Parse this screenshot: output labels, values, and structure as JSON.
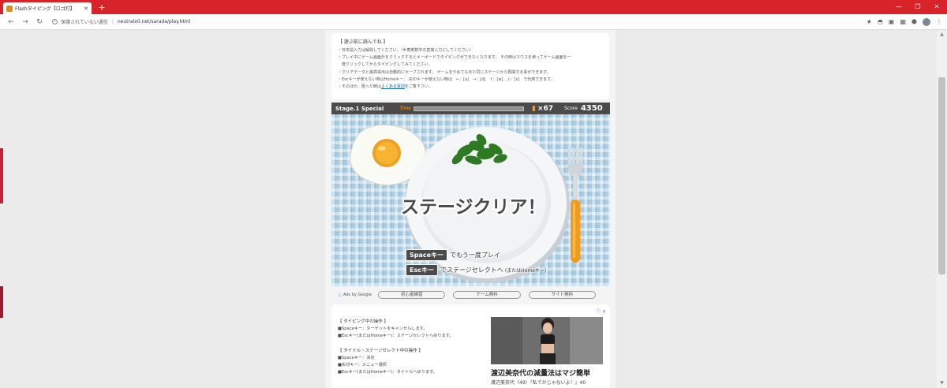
{
  "browser": {
    "tab_title": "Flashタイピング【ロゴ打】",
    "tab_close": "✕",
    "new_tab": "+",
    "nav": {
      "back": "←",
      "forward": "→",
      "reload": "↻"
    },
    "security_label": "保護されていない通信",
    "url": "neutralx0.net/sarada/play.html",
    "toolbar_icons": {
      "bookmark": "★",
      "menu": "⋮"
    },
    "window_controls": {
      "minimize": "—",
      "restore": "❐",
      "close": "✕"
    }
  },
  "notice": {
    "title": "【 遊ぶ前に読んでね 】",
    "lines": [
      "・日本語入力は解除してください。（半角英数字の直接入力にしてください）",
      "・プレイ中にゲーム画面外をクリックするとキーボードでタイピングができなくなります。 その時はマウスを使ってゲーム画面を一",
      "　度クリックしてからタイピングしてみてください。",
      "・クリアデータと最高得点は自動的にセーブされます。 ゲームをやめてもまた同じステージから再開する事ができます。",
      "・Escキーが使えない時はHomeキー、 矢印キーが使えない時は　←：[a]　→：[d]　↑：[w]　↓：[s]　で代用できます。"
    ],
    "last_line_pre": "・そのほか、困った時は",
    "faq_link": "よくある質問",
    "last_line_post": "をご覧下さい。"
  },
  "hud": {
    "stage": "Stage.1 Special",
    "time_label": "Time",
    "time_fraction": 1.0,
    "multiplier": "×67",
    "score_label": "Score",
    "score": "4350"
  },
  "game": {
    "clear_message": "ステージクリア！",
    "option1_key": "Spaceキー",
    "option1_text": "でもう一度プレイ",
    "option2_key": "Escキー",
    "option2_text": "でステージセレクトへ",
    "option2_note": "(またはHomeキー)"
  },
  "adlinks": {
    "ads_by": "Ads by Google",
    "links": [
      "初心者練習",
      "ゲーム無料",
      "サイト無料"
    ]
  },
  "help": {
    "section1_title": "【 タイピング中の操作 】",
    "section1_items": [
      "■Spaceキー：ターゲットをキャンセルします。",
      "■Escキー(またはHomeキー)：ステージセレクトへ戻ります。"
    ],
    "section2_title": "【 タイトル・ステージセレクト中の操作 】",
    "section2_items": [
      "■Spaceキー：決定",
      "■矢印キー：メニュー選択",
      "■Escキー(またはHomeキー)：タイトルへ戻ります。"
    ]
  },
  "ad": {
    "icons": "ⓘ ✕",
    "title": "渡辺美奈代の減量法はマジ簡単",
    "body": "渡辺美奈代（49）『私でかじゃないよ！』40"
  }
}
